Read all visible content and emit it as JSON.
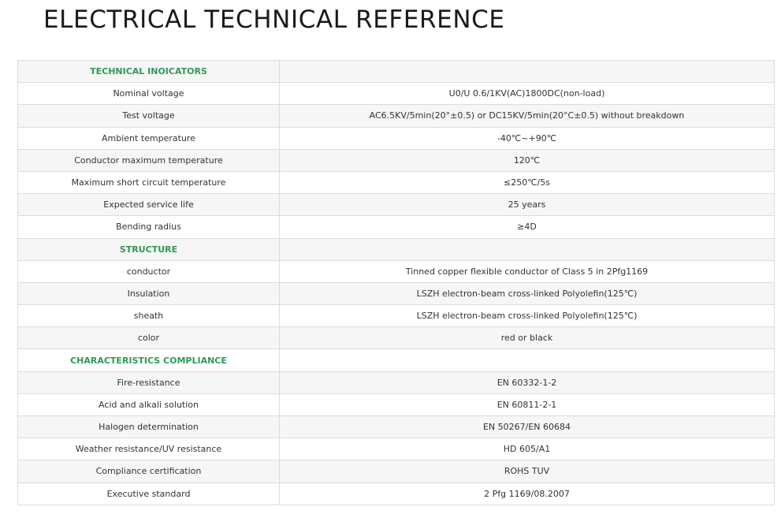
{
  "title": "ELECTRICAL TECHNICAL REFERENCE",
  "colors": {
    "section_heading": "#2e9a55",
    "row_alt": "#f6f6f6",
    "border": "#dcdcdc"
  },
  "rows": [
    {
      "section": true,
      "label": "TECHNICAL INOICATORS",
      "value": ""
    },
    {
      "label": "Nominal voltage",
      "value": "U0/U 0.6/1KV(AC)1800DC(non-load)"
    },
    {
      "label": "Test voltage",
      "value": "AC6.5KV/5min(20°±0.5) or DC15KV/5min(20°C±0.5) without breakdown"
    },
    {
      "label": "Ambient temperature",
      "value": "-40℃~+90℃"
    },
    {
      "label": "Conductor maximum temperature",
      "value": "120℃"
    },
    {
      "label": "Maximum short circuit temperature",
      "value": "≤250℃/5s"
    },
    {
      "label": "Expected service life",
      "value": "25 years"
    },
    {
      "label": "Bending radius",
      "value": "≥4D"
    },
    {
      "section": true,
      "label": "STRUCTURE",
      "value": ""
    },
    {
      "label": "conductor",
      "value": "Tinned copper flexible conductor of Class 5 in 2Pfg1169"
    },
    {
      "label": "Insulation",
      "value": "LSZH electron-beam cross-linked Polyolefin(125℃)"
    },
    {
      "label": "sheath",
      "value": "LSZH electron-beam cross-linked Polyolefin(125℃)"
    },
    {
      "label": "color",
      "value": "red or black"
    },
    {
      "section": true,
      "label": "CHARACTERISTICS COMPLIANCE",
      "value": ""
    },
    {
      "label": "Fire-resistance",
      "value": "EN 60332-1-2"
    },
    {
      "label": "Acid and alkali solution",
      "value": "EN 60811-2-1"
    },
    {
      "label": "Halogen determination",
      "value": "EN 50267/EN 60684"
    },
    {
      "label": "Weather resistance/UV resistance",
      "value": "HD 605/A1"
    },
    {
      "label": "Compliance certification",
      "value": "ROHS TUV"
    },
    {
      "label": "Executive standard",
      "value": "2 Pfg 1169/08.2007"
    }
  ]
}
